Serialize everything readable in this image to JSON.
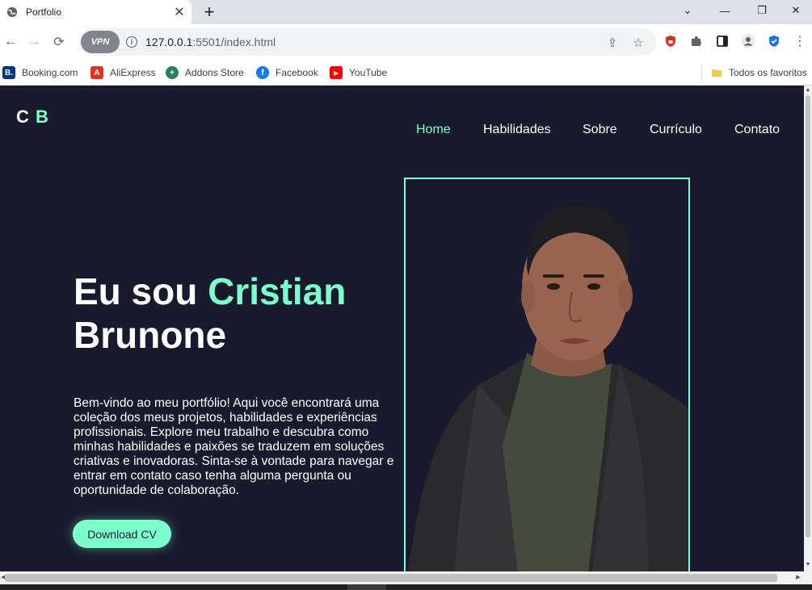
{
  "browser": {
    "tab_title": "Portfolio",
    "url_host": "127.0.0.1",
    "url_rest": ":5501/index.html",
    "vpn_label": "VPN",
    "bookmarks": [
      {
        "label": "Booking.com",
        "color": "#003580",
        "glyph": "B."
      },
      {
        "label": "AliExpress",
        "color": "#e43225",
        "glyph": "A"
      },
      {
        "label": "Addons Store",
        "color": "#2e7d5b",
        "glyph": "+"
      },
      {
        "label": "Facebook",
        "color": "#1877f2",
        "glyph": "f"
      },
      {
        "label": "YouTube",
        "color": "#ff0000",
        "glyph": "▶"
      }
    ],
    "favorites_label": "Todos os favoritos"
  },
  "page": {
    "logo_first": "C",
    "logo_second": "B",
    "nav": [
      "Home",
      "Habilidades",
      "Sobre",
      "Currículo",
      "Contato"
    ],
    "hero_prefix": "Eu sou ",
    "hero_name": "Cristian",
    "hero_surname": "Brunone",
    "intro": "Bem-vindo ao meu portfólio! Aqui você encontrará uma coleção dos meus projetos, habilidades e experiências profissionais. Explore meu trabalho e descubra como minhas habilidades e paixões se traduzem em soluções criativas e inovadoras. Sinta-se à vontade para navegar e entrar em contato caso tenha alguma pergunta ou oportunidade de colaboração.",
    "cta_label": "Download CV"
  },
  "colors": {
    "background": "#1a1a2e",
    "accent": "#7cffcb",
    "text": "#ffffff"
  }
}
